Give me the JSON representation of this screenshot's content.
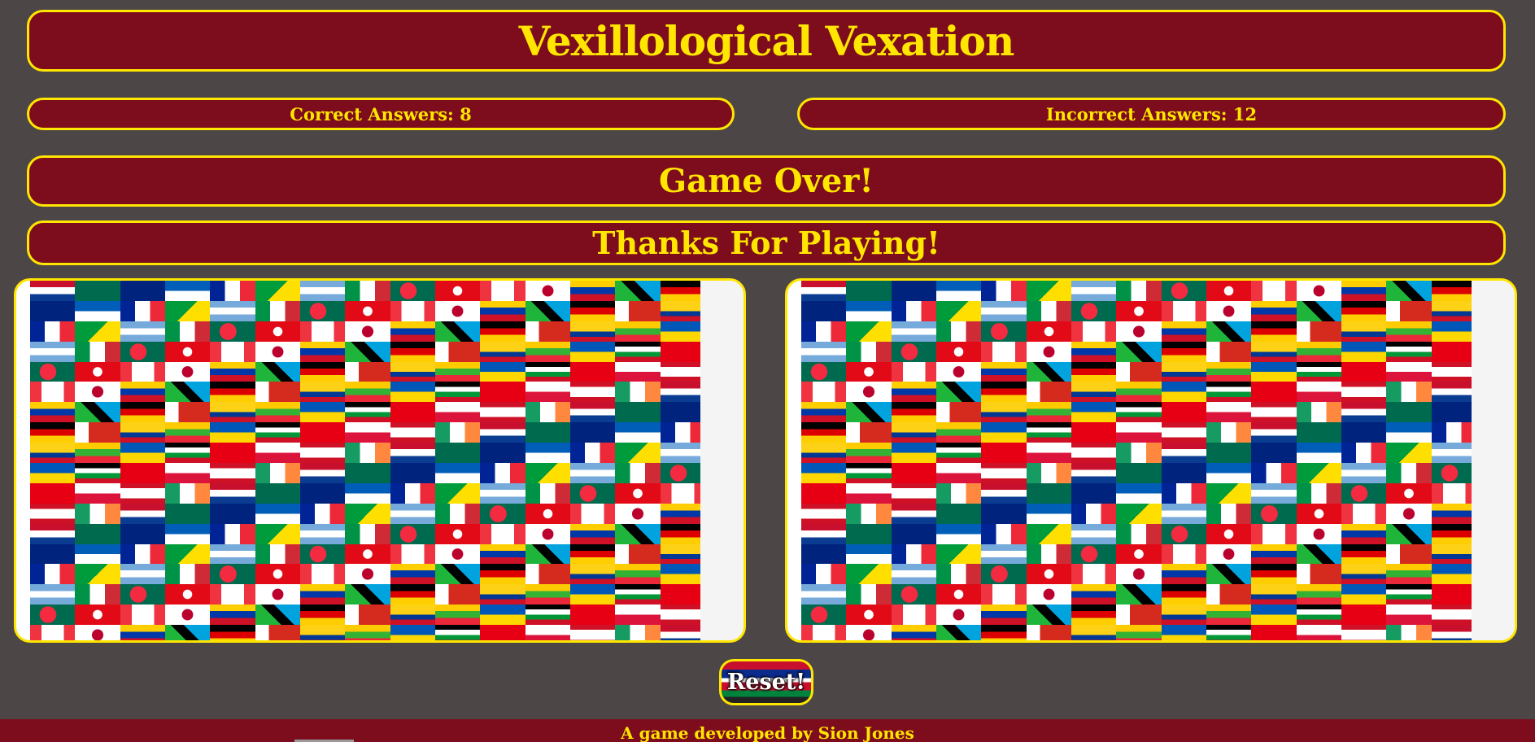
{
  "game": {
    "title": "Vexillological Vexation",
    "correct_label": "Correct Answers: 8",
    "incorrect_label": "Incorrect Answers: 12",
    "game_over": "Game Over!",
    "thanks": "Thanks For Playing!",
    "reset_label": "Reset!",
    "footer": "A game developed by Sion Jones"
  },
  "colors": {
    "background": "#4d4646",
    "panel": "#7d0d1c",
    "accent": "#ffe600"
  },
  "images": {
    "left": "flags-collage-image",
    "right": "flags-collage-image"
  }
}
